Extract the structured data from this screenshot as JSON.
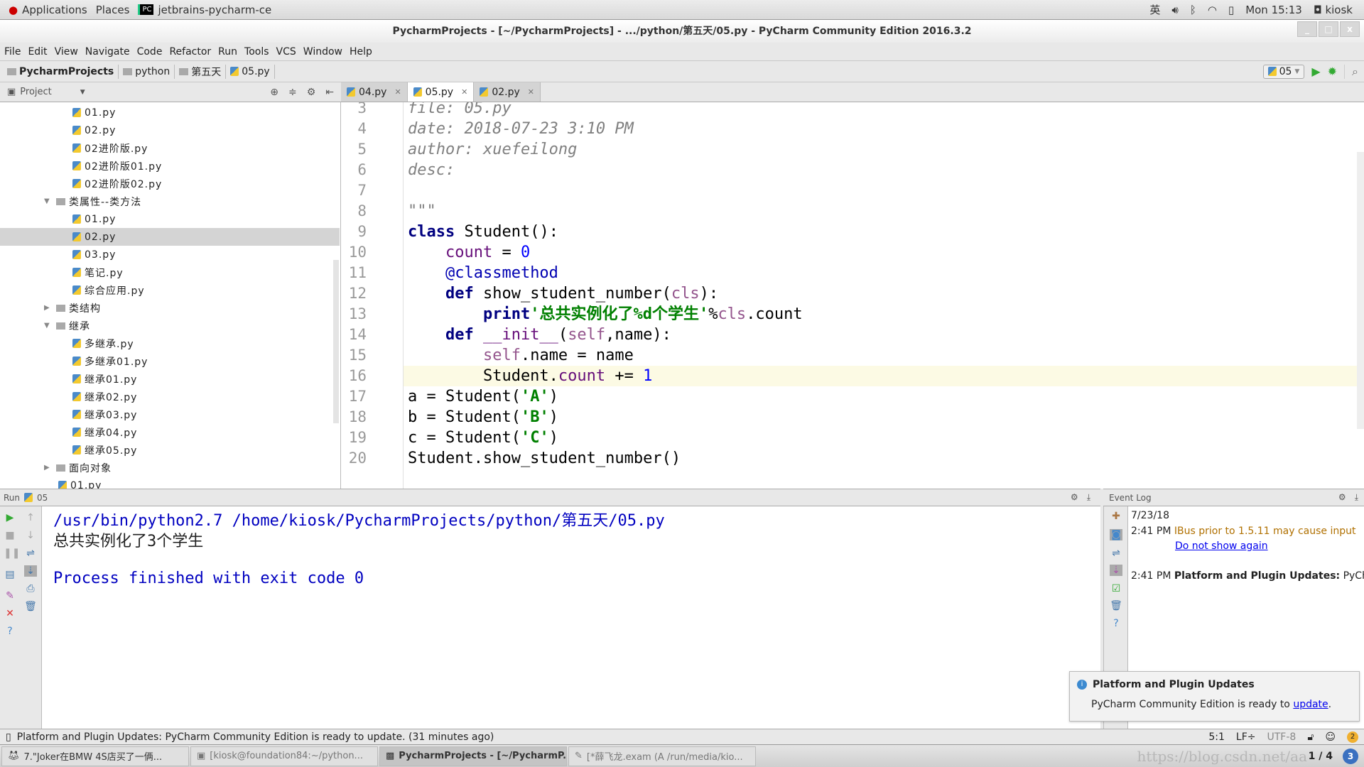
{
  "system_bar": {
    "applications": "Applications",
    "places": "Places",
    "app_name": "jetbrains-pycharm-ce",
    "input_method": "英",
    "clock": "Mon 15:13",
    "user": "kiosk"
  },
  "window": {
    "title": "PycharmProjects - [~/PycharmProjects] - .../python/第五天/05.py - PyCharm Community Edition 2016.3.2"
  },
  "menu": [
    "File",
    "Edit",
    "View",
    "Navigate",
    "Code",
    "Refactor",
    "Run",
    "Tools",
    "VCS",
    "Window",
    "Help"
  ],
  "breadcrumb": [
    "PycharmProjects",
    "python",
    "第五天",
    "05.py"
  ],
  "run_config": {
    "name": "05"
  },
  "project_panel": {
    "title": "Project",
    "tree": [
      {
        "label": "01.py",
        "type": "file",
        "depth": 2
      },
      {
        "label": "02.py",
        "type": "file",
        "depth": 2
      },
      {
        "label": "02进阶版.py",
        "type": "file",
        "depth": 2
      },
      {
        "label": "02进阶版01.py",
        "type": "file",
        "depth": 2
      },
      {
        "label": "02进阶版02.py",
        "type": "file",
        "depth": 2
      },
      {
        "label": "类属性--类方法",
        "type": "folder",
        "depth": 1,
        "expanded": true
      },
      {
        "label": "01.py",
        "type": "file",
        "depth": 2
      },
      {
        "label": "02.py",
        "type": "file",
        "depth": 2,
        "selected": true
      },
      {
        "label": "03.py",
        "type": "file",
        "depth": 2
      },
      {
        "label": "笔记.py",
        "type": "file",
        "depth": 2
      },
      {
        "label": "综合应用.py",
        "type": "file",
        "depth": 2
      },
      {
        "label": "类结构",
        "type": "folder",
        "depth": 1,
        "expanded": false
      },
      {
        "label": "继承",
        "type": "folder",
        "depth": 1,
        "expanded": true
      },
      {
        "label": "多继承.py",
        "type": "file",
        "depth": 2
      },
      {
        "label": "多继承01.py",
        "type": "file",
        "depth": 2
      },
      {
        "label": "继承01.py",
        "type": "file",
        "depth": 2
      },
      {
        "label": "继承02.py",
        "type": "file",
        "depth": 2
      },
      {
        "label": "继承03.py",
        "type": "file",
        "depth": 2
      },
      {
        "label": "继承04.py",
        "type": "file",
        "depth": 2
      },
      {
        "label": "继承05.py",
        "type": "file",
        "depth": 2
      },
      {
        "label": "面向对象",
        "type": "folder",
        "depth": 1,
        "expanded": false
      },
      {
        "label": "01.py",
        "type": "file",
        "depth": 1
      }
    ]
  },
  "tabs": [
    {
      "label": "04.py",
      "active": false
    },
    {
      "label": "05.py",
      "active": true
    },
    {
      "label": "02.py",
      "active": false
    }
  ],
  "editor": {
    "current_line": 16,
    "lines": [
      {
        "n": "3",
        "tokens": [
          [
            "doc",
            "file: 05.py"
          ]
        ]
      },
      {
        "n": "4",
        "tokens": [
          [
            "doc",
            "date: 2018-07-23 3:10 PM"
          ]
        ]
      },
      {
        "n": "5",
        "tokens": [
          [
            "doc",
            "author: xuefeilong"
          ]
        ]
      },
      {
        "n": "6",
        "tokens": [
          [
            "doc",
            "desc:"
          ]
        ]
      },
      {
        "n": "7",
        "tokens": []
      },
      {
        "n": "8",
        "tokens": [
          [
            "doc",
            "\"\"\""
          ]
        ]
      },
      {
        "n": "9",
        "tokens": [
          [
            "kw",
            "class "
          ],
          [
            "",
            "Student():"
          ]
        ]
      },
      {
        "n": "10",
        "tokens": [
          [
            "",
            "    "
          ],
          [
            "fld",
            "count"
          ],
          [
            "",
            " = "
          ],
          [
            "num",
            "0"
          ]
        ]
      },
      {
        "n": "11",
        "tokens": [
          [
            "",
            "    "
          ],
          [
            "dec",
            "@classmethod"
          ]
        ]
      },
      {
        "n": "12",
        "tokens": [
          [
            "",
            "    "
          ],
          [
            "kw",
            "def "
          ],
          [
            "",
            "show_student_number("
          ],
          [
            "slf",
            "cls"
          ],
          [
            "",
            "):"
          ]
        ]
      },
      {
        "n": "13",
        "tokens": [
          [
            "",
            "        "
          ],
          [
            "kw",
            "print"
          ],
          [
            "str",
            "'总共实例化了%d个学生'"
          ],
          [
            "",
            "%"
          ],
          [
            "slf",
            "cls"
          ],
          [
            "",
            ".count"
          ]
        ]
      },
      {
        "n": "14",
        "tokens": [
          [
            "",
            "    "
          ],
          [
            "kw",
            "def "
          ],
          [
            "fld",
            "__init__"
          ],
          [
            "",
            "("
          ],
          [
            "slf",
            "self"
          ],
          [
            "",
            ",name):"
          ]
        ]
      },
      {
        "n": "15",
        "tokens": [
          [
            "",
            "        "
          ],
          [
            "slf",
            "self"
          ],
          [
            "",
            ".name = name"
          ]
        ]
      },
      {
        "n": "16",
        "tokens": [
          [
            "",
            "        Student."
          ],
          [
            "fld",
            "count"
          ],
          [
            "",
            " += "
          ],
          [
            "num",
            "1"
          ]
        ]
      },
      {
        "n": "17",
        "tokens": [
          [
            "",
            "a = Student("
          ],
          [
            "str",
            "'A'"
          ],
          [
            "",
            ")"
          ]
        ]
      },
      {
        "n": "18",
        "tokens": [
          [
            "",
            "b = Student("
          ],
          [
            "str",
            "'B'"
          ],
          [
            "",
            ")"
          ]
        ]
      },
      {
        "n": "19",
        "tokens": [
          [
            "",
            "c = Student("
          ],
          [
            "str",
            "'C'"
          ],
          [
            "",
            ")"
          ]
        ]
      },
      {
        "n": "20",
        "tokens": [
          [
            "",
            "Student.show_student_number()"
          ]
        ]
      }
    ]
  },
  "run_panel": {
    "label": "Run",
    "config": "05",
    "output": [
      "/usr/bin/python2.7 /home/kiosk/PycharmProjects/python/第五天/05.py",
      "总共实例化了3个学生",
      "",
      "Process finished with exit code 0"
    ]
  },
  "event_log": {
    "title": "Event Log",
    "date": "7/23/18",
    "entries": [
      {
        "time": "2:41 PM",
        "message": "IBus prior to 1.5.11 may cause input",
        "link": "Do not show again"
      },
      {
        "time": "2:41 PM",
        "title": "Platform and Plugin Updates:",
        "message": "PyCh"
      }
    ]
  },
  "notification": {
    "title": "Platform and Plugin Updates",
    "text": "PyCharm Community Edition is ready to ",
    "link": "update"
  },
  "status_bar": {
    "message": "Platform and Plugin Updates: PyCharm Community Edition is ready to update. (31 minutes ago)",
    "position": "5:1",
    "line_sep": "LF÷",
    "encoding": "UTF-8",
    "notifications": "2"
  },
  "taskbar": {
    "items": [
      {
        "label": "7.\"Joker在BMW 4S店买了一俩...",
        "state": "normal"
      },
      {
        "label": "[kiosk@foundation84:~/python...",
        "state": "dim"
      },
      {
        "label": "PycharmProjects - [~/PycharmP...",
        "state": "active"
      },
      {
        "label": "[*薛飞龙.exam (A /run/media/kio...",
        "state": "dim"
      }
    ],
    "workspace": "1 / 4",
    "badge": "3"
  },
  "watermark": "https://blog.csdn.net/aa"
}
